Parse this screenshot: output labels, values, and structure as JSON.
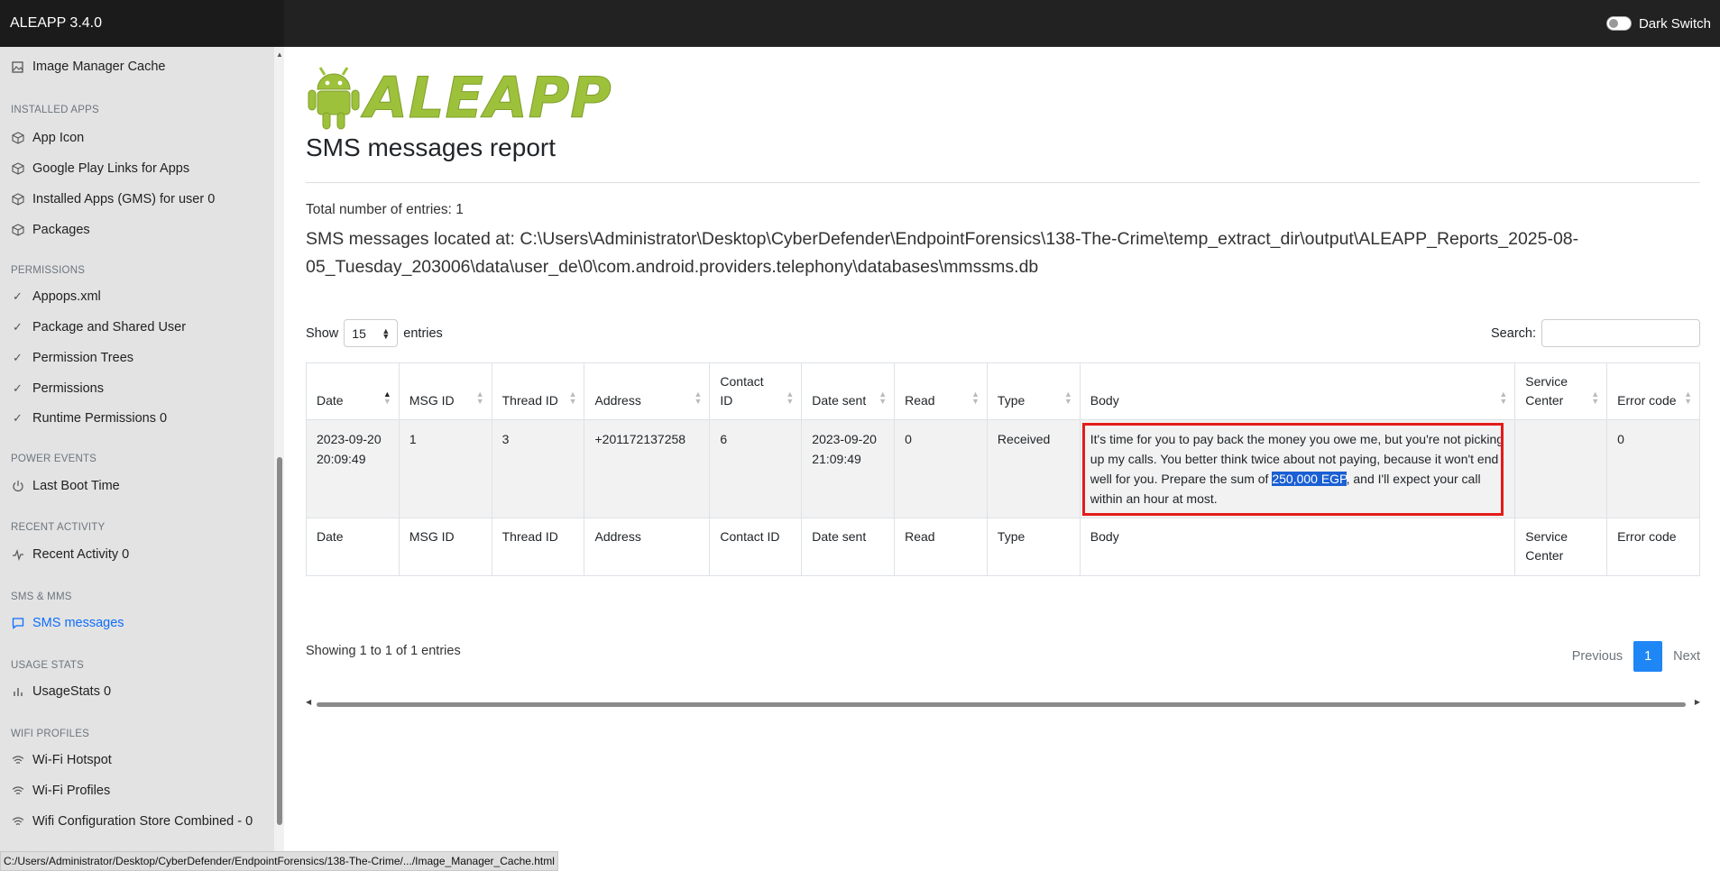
{
  "app": {
    "title": "ALEAPP 3.4.0",
    "dark_switch_label": "Dark Switch"
  },
  "sidebar": {
    "top_item": {
      "label": "Image Manager Cache",
      "icon": "image-icon"
    },
    "sections": [
      {
        "heading": "INSTALLED APPS",
        "items": [
          {
            "label": "App Icon",
            "icon": "package-icon"
          },
          {
            "label": "Google Play Links for Apps",
            "icon": "package-icon"
          },
          {
            "label": "Installed Apps (GMS) for user 0",
            "icon": "package-icon"
          },
          {
            "label": "Packages",
            "icon": "package-icon"
          }
        ]
      },
      {
        "heading": "PERMISSIONS",
        "items": [
          {
            "label": "Appops.xml",
            "icon": "check-icon"
          },
          {
            "label": "Package and Shared User",
            "icon": "check-icon"
          },
          {
            "label": "Permission Trees",
            "icon": "check-icon"
          },
          {
            "label": "Permissions",
            "icon": "check-icon"
          },
          {
            "label": "Runtime Permissions 0",
            "icon": "check-icon"
          }
        ]
      },
      {
        "heading": "POWER EVENTS",
        "items": [
          {
            "label": "Last Boot Time",
            "icon": "power-icon"
          }
        ]
      },
      {
        "heading": "RECENT ACTIVITY",
        "items": [
          {
            "label": "Recent Activity 0",
            "icon": "activity-icon"
          }
        ]
      },
      {
        "heading": "SMS & MMS",
        "items": [
          {
            "label": "SMS messages",
            "icon": "message-icon",
            "active": true
          }
        ]
      },
      {
        "heading": "USAGE STATS",
        "items": [
          {
            "label": "UsageStats 0",
            "icon": "bar-chart-icon"
          }
        ]
      },
      {
        "heading": "WIFI PROFILES",
        "items": [
          {
            "label": "Wi-Fi Hotspot",
            "icon": "wifi-icon"
          },
          {
            "label": "Wi-Fi Profiles",
            "icon": "wifi-icon"
          },
          {
            "label": "Wifi Configuration Store Combined - 0",
            "icon": "wifi-icon"
          }
        ]
      }
    ]
  },
  "status_bar": "C:/Users/Administrator/Desktop/CyberDefender/EndpointForensics/138-The-Crime/.../Image_Manager_Cache.html",
  "main": {
    "logo_text": "ALEAPP",
    "page_title": "SMS messages report",
    "total_entries": "Total number of entries: 1",
    "location": "SMS messages located at: C:\\Users\\Administrator\\Desktop\\CyberDefender\\EndpointForensics\\138-The-Crime\\temp_extract_dir\\output\\ALEAPP_Reports_2025-08-05_Tuesday_203006\\data\\user_de\\0\\com.android.providers.telephony\\databases\\mmssms.db",
    "show_label": "Show",
    "entries_label": "entries",
    "page_length": "15",
    "search_label": "Search:",
    "search_value": "",
    "table": {
      "header": [
        "Date",
        "MSG ID",
        "Thread ID",
        "Address",
        "Contact ID",
        "Date sent",
        "Read",
        "Type",
        "Body",
        "Service Center",
        "Error code"
      ],
      "footer": [
        "Date",
        "MSG ID",
        "Thread ID",
        "Address",
        "Contact ID",
        "Date sent",
        "Read",
        "Type",
        "Body",
        "Service Center",
        "Error code"
      ],
      "rows": [
        {
          "date": "2023-09-20 20:09:49",
          "msg_id": "1",
          "thread_id": "3",
          "address": "+201172137258",
          "contact_id": "6",
          "date_sent": "2023-09-20 21:09:49",
          "read": "0",
          "type": "Received",
          "body_before": "It's time for you to pay back the money you owe me, but you're not picking up my calls. You better think twice about not paying, because it won't end well for you. Prepare the sum of ",
          "body_highlight": "250,000 EGP",
          "body_after": ", and I'll expect your call within an hour at most.",
          "service_center": "",
          "error_code": "0"
        }
      ]
    },
    "showing": "Showing 1 to 1 of 1 entries",
    "pager": {
      "previous": "Previous",
      "current": "1",
      "next": "Next"
    }
  },
  "colors": {
    "active_link": "#0d6efd",
    "highlight": "#1a5fd3",
    "annotation_box": "#e41b1b",
    "logo": "#9dc13b",
    "page_button": "#1e86f5"
  }
}
